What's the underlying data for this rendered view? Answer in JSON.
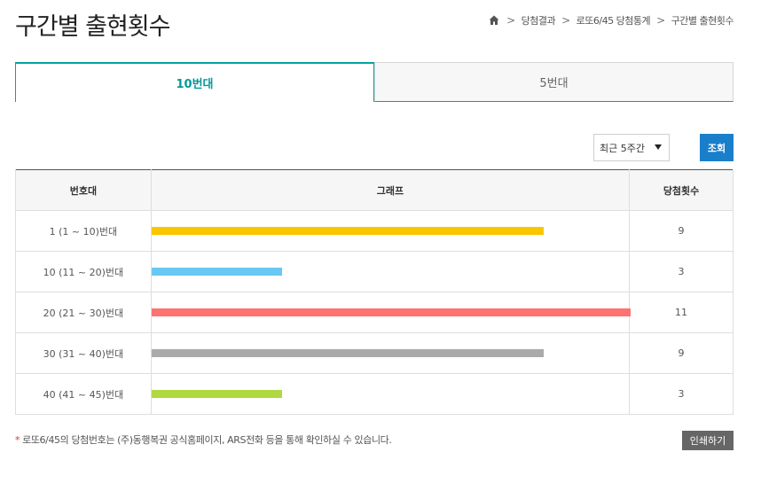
{
  "page": {
    "title": "구간별 출현횟수"
  },
  "breadcrumb": {
    "items": [
      "당첨결과",
      "로또6/45 당첨통계",
      "구간별 출현횟수"
    ]
  },
  "tabs": [
    {
      "label": "10번대",
      "active": true
    },
    {
      "label": "5번대",
      "active": false
    }
  ],
  "filter": {
    "selected": "최근 5주간",
    "search_label": "조회"
  },
  "table": {
    "headers": [
      "번호대",
      "그래프",
      "당첨횟수"
    ],
    "max_value": 11,
    "rows": [
      {
        "range": "1 (1 ~ 10)번대",
        "count": 9,
        "color": "#f9c600"
      },
      {
        "range": "10 (11 ~ 20)번대",
        "count": 3,
        "color": "#69c8f2"
      },
      {
        "range": "20 (21 ~ 30)번대",
        "count": 11,
        "color": "#ff7272"
      },
      {
        "range": "30 (31 ~ 40)번대",
        "count": 9,
        "color": "#aaaaaa"
      },
      {
        "range": "40 (41 ~ 45)번대",
        "count": 3,
        "color": "#b0d840"
      }
    ]
  },
  "footer": {
    "note": "로또6/45의 당첨번호는 (주)동행복권 공식홈페이지, ARS전화 등을 통해 확인하실 수 있습니다.",
    "print_label": "인쇄하기"
  }
}
